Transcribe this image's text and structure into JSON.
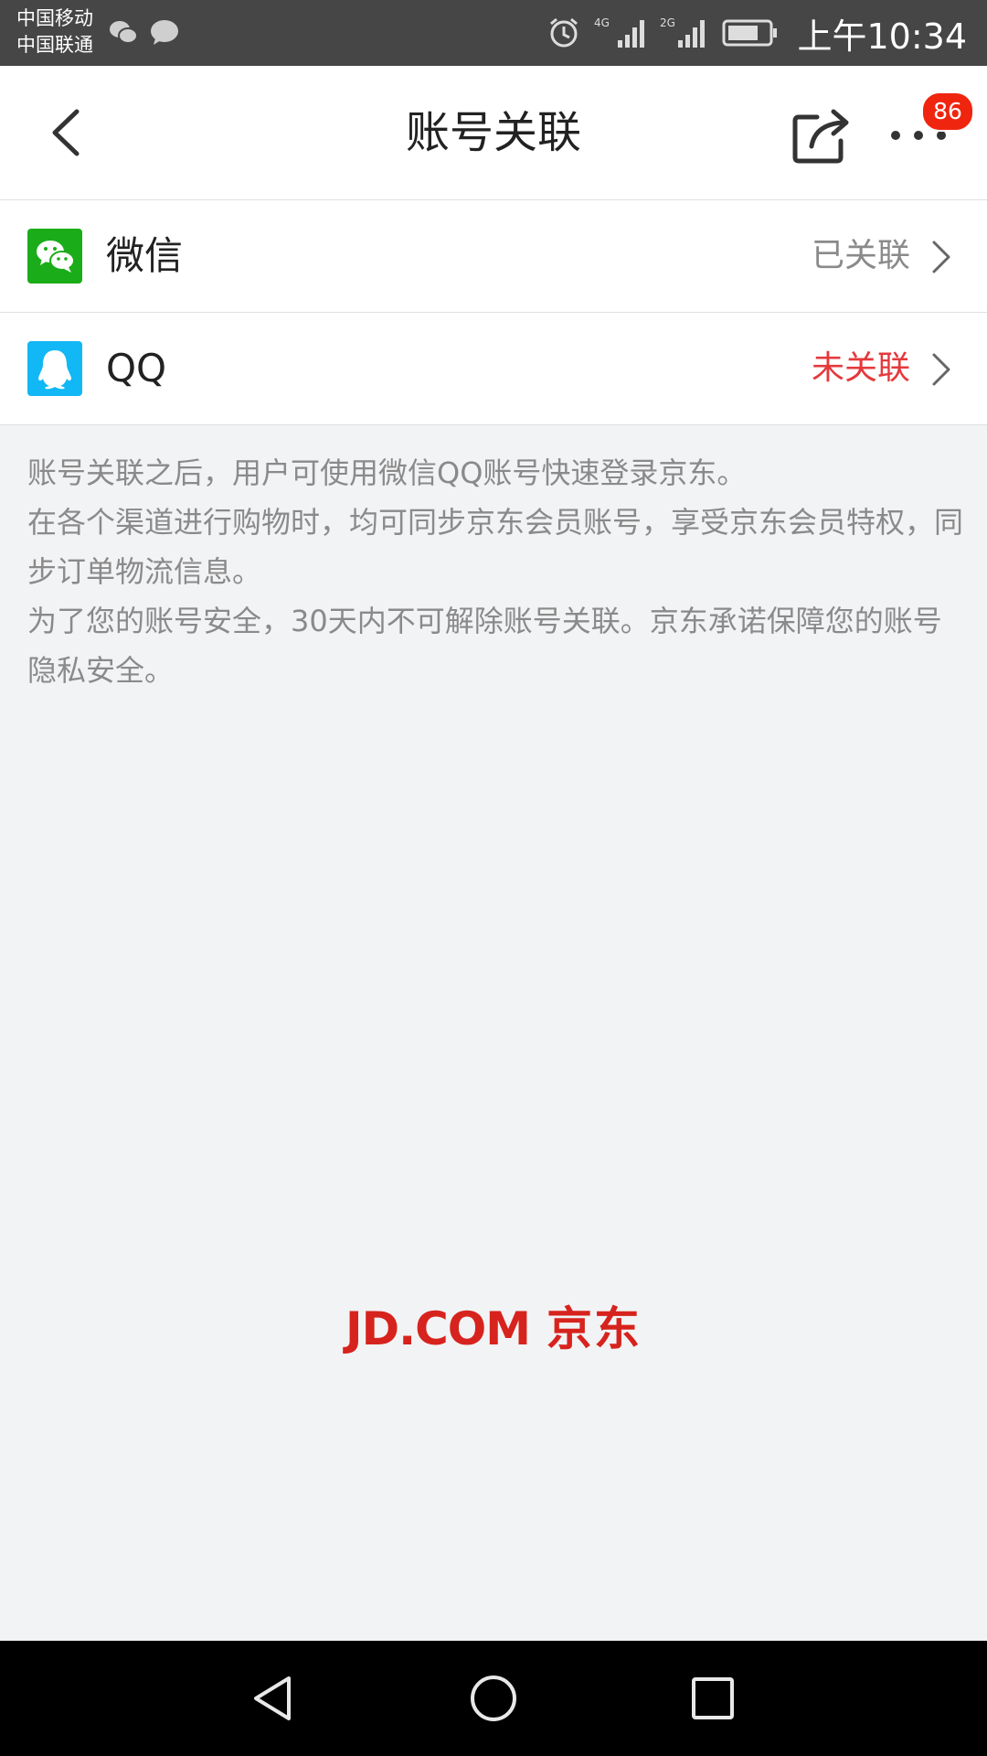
{
  "status_bar": {
    "carrier_1": "中国移动",
    "carrier_2": "中国联通",
    "network_1": "4G",
    "network_2": "2G",
    "time": "上午10:34",
    "icons": [
      "wechat-icon",
      "message-icon",
      "alarm-icon",
      "signal-icon",
      "signal-icon",
      "battery-icon"
    ]
  },
  "header": {
    "title": "账号关联",
    "back_icon": "chevron-left-icon",
    "share_icon": "share-icon",
    "more_icon": "more-dots-icon",
    "badge_count": "86"
  },
  "accounts": [
    {
      "name": "微信",
      "status": "已关联",
      "icon": "wechat-icon",
      "icon_color": "#1aad19",
      "status_color": "#8a8a8a"
    },
    {
      "name": "QQ",
      "status": "未关联",
      "icon": "qq-icon",
      "icon_color": "#12b7f5",
      "status_color": "#e4393c"
    }
  ],
  "description": {
    "line_1": "账号关联之后，用户可使用微信QQ账号快速登录京东。",
    "line_2": "在各个渠道进行购物时，均可同步京东会员账号，享受京东会员特权，同步订单物流信息。",
    "line_3": "为了您的账号安全，30天内不可解除账号关联。京东承诺保障您的账号隐私安全。"
  },
  "footer_logo": {
    "latin": "JD.COM",
    "chinese": "京东",
    "color": "#d7231d"
  },
  "nav_bar": {
    "icons": [
      "nav-back-icon",
      "nav-home-icon",
      "nav-recents-icon"
    ]
  }
}
